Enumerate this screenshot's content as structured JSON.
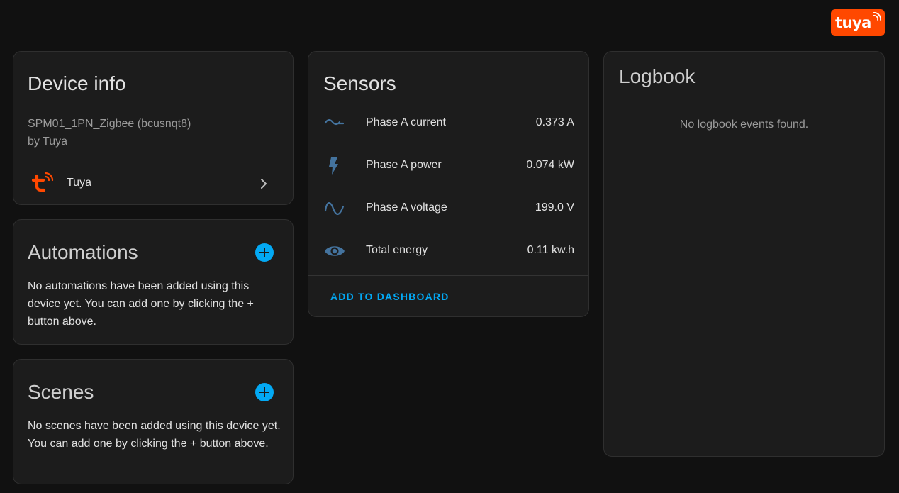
{
  "brand": {
    "logo_text": "tuya",
    "color": "#ff4800"
  },
  "device_info": {
    "title": "Device info",
    "model": "SPM01_1PN_Zigbee (bcusnqt8)",
    "manufacturer": "by Tuya",
    "integration": {
      "name": "Tuya",
      "icon": "tuya-logo-icon",
      "trailing_icon": "chevron-right-icon"
    }
  },
  "automations": {
    "title": "Automations",
    "add_icon": "plus-circle-icon",
    "empty_text": "No automations have been added using this device yet. You can add one by clicking the + button above."
  },
  "scenes": {
    "title": "Scenes",
    "add_icon": "plus-circle-icon",
    "empty_text": "No scenes have been added using this device yet. You can add one by clicking the + button above."
  },
  "sensors": {
    "title": "Sensors",
    "items": [
      {
        "name": "Phase A current",
        "value": "0.373 A",
        "icon": "current-ac-icon"
      },
      {
        "name": "Phase A power",
        "value": "0.074 kW",
        "icon": "flash-icon"
      },
      {
        "name": "Phase A voltage",
        "value": "199.0 V",
        "icon": "sine-wave-icon"
      },
      {
        "name": "Total energy",
        "value": "0.11 kw.h",
        "icon": "eye-icon"
      }
    ],
    "add_to_dashboard": "ADD TO DASHBOARD"
  },
  "logbook": {
    "title": "Logbook",
    "empty_text": "No logbook events found."
  },
  "colors": {
    "background": "#111111",
    "card": "#1c1c1c",
    "accent": "#03a9f4",
    "icon": "#44739e",
    "brand": "#ff4800"
  }
}
